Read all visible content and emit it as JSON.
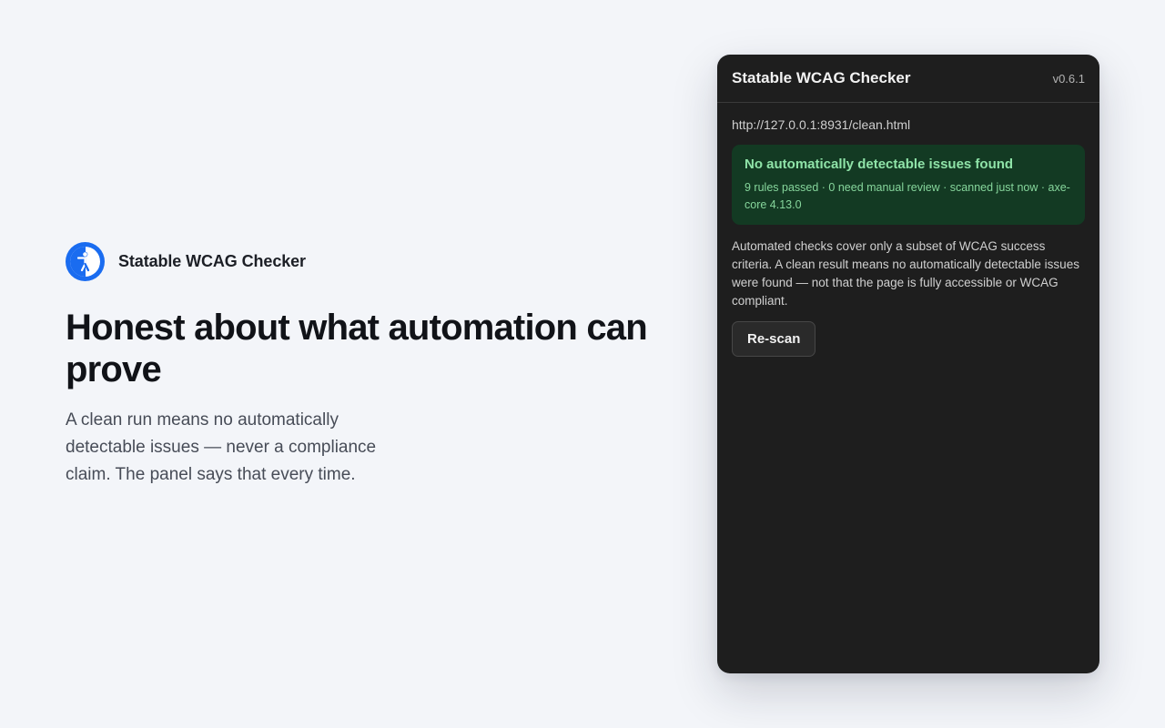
{
  "hero": {
    "brand_name": "Statable WCAG Checker",
    "logo_icon": "accessibility-icon",
    "headline": "Honest about what automation can prove",
    "subcopy": "A clean run means no automatically detectable issues — never a compliance claim. The panel says that every time."
  },
  "panel": {
    "title": "Statable WCAG Checker",
    "version": "v0.6.1",
    "url": "http://127.0.0.1:8931/clean.html",
    "result": {
      "title": "No automatically detectable issues found",
      "meta": "9 rules passed · 0 need manual review · scanned just now · axe-core 4.13.0"
    },
    "disclaimer": "Automated checks cover only a subset of WCAG success criteria. A clean result means no automatically detectable issues were found — not that the page is fully accessible or WCAG compliant.",
    "rescan_label": "Re-scan"
  },
  "colors": {
    "brand": "#1a6cf0",
    "panel_bg": "#1e1e1e",
    "success_bg": "#133a23",
    "success_text": "#8fe3a8"
  }
}
